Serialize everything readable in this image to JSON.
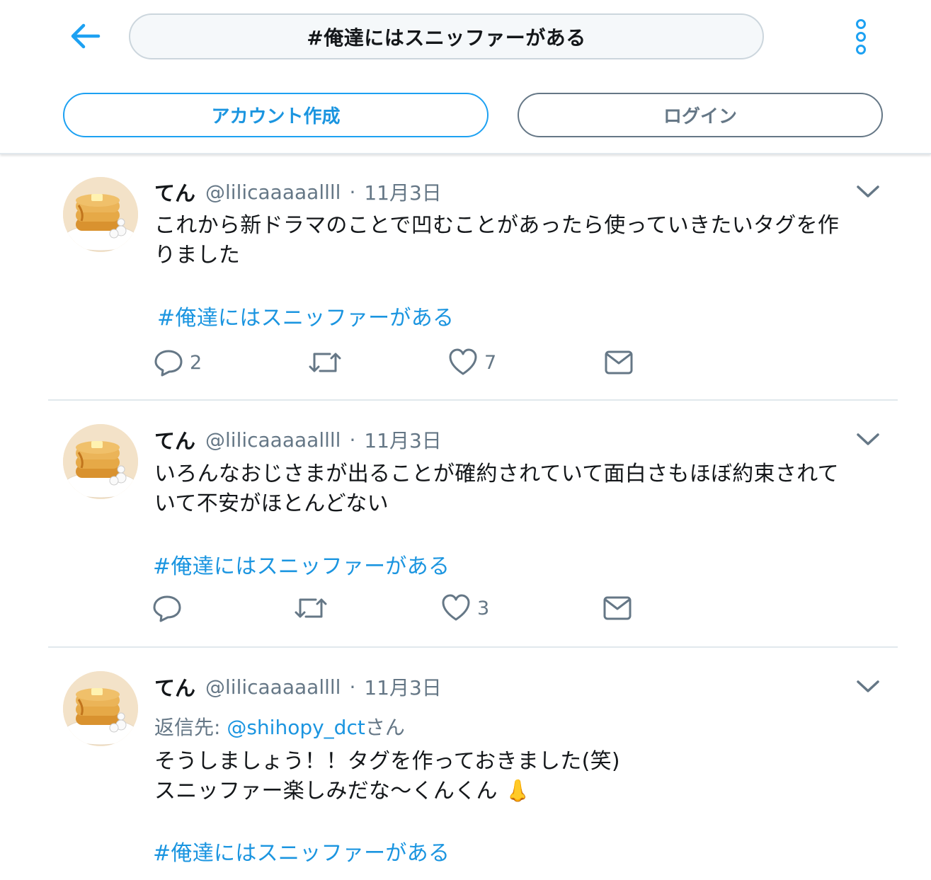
{
  "header": {
    "search_text": "#俺達にはスニッファーがある",
    "accent_color": "#1da1f2",
    "back_icon": "arrow-left-icon",
    "more_icon": "more-vertical-icon"
  },
  "auth": {
    "signup_label": "アカウント作成",
    "login_label": "ログイン"
  },
  "tweets": [
    {
      "name": "てん",
      "handle": "@lilicaaaaallll",
      "sep": "·",
      "date": "11月3日",
      "text": "これから新ドラマのことで凹むことがあったら使っていきたいタグを作\nりました",
      "hashtag": "#俺達にはスニッファーがある",
      "reply_count": "2",
      "like_count": "7"
    },
    {
      "name": "てん",
      "handle": "@lilicaaaaallll",
      "sep": "·",
      "date": "11月3日",
      "text": "いろんなおじさまが出ることが確約されていて面白さもほぼ約束されて\nいて不安がほとんどない",
      "hashtag": "#俺達にはスニッファーがある",
      "like_count": "3"
    },
    {
      "name": "てん",
      "handle": "@lilicaaaaallll",
      "sep": "·",
      "date": "11月3日",
      "reply_prefix": "返信先: ",
      "reply_mention": "@shihopy_dct",
      "reply_suffix": "さん",
      "text": "そうしましょう！！タグを作っておきました(笑)\nスニッファー楽しみだな〜くんくん 👃",
      "hashtag": "#俺達にはスニッファーがある"
    }
  ]
}
